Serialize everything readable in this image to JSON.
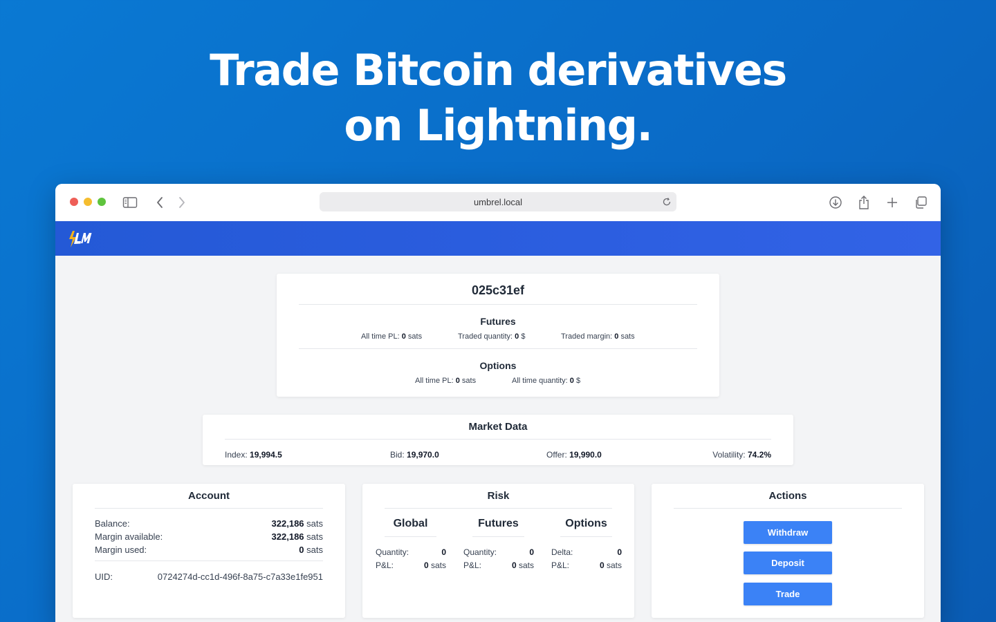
{
  "hero": {
    "line1": "Trade Bitcoin derivatives",
    "line2": "on Lightning."
  },
  "browser": {
    "url": "umbrel.local",
    "icons": [
      "sidebar-icon",
      "back-icon",
      "forward-icon",
      "reload-icon",
      "download-icon",
      "share-icon",
      "new-tab-icon",
      "tabs-overview-icon"
    ]
  },
  "app": {
    "logo_text": "LNM",
    "brand_color": "#2c5ee0",
    "accent_color": "#3b82f6"
  },
  "profile": {
    "title": "025c31ef",
    "futures": {
      "heading": "Futures",
      "all_time_pl_label": "All time PL:",
      "all_time_pl_value": "0",
      "all_time_pl_unit": "sats",
      "traded_quantity_label": "Traded quantity:",
      "traded_quantity_value": "0",
      "traded_quantity_unit": "$",
      "traded_margin_label": "Traded margin:",
      "traded_margin_value": "0",
      "traded_margin_unit": "sats"
    },
    "options": {
      "heading": "Options",
      "all_time_pl_label": "All time PL:",
      "all_time_pl_value": "0",
      "all_time_pl_unit": "sats",
      "all_time_quantity_label": "All time quantity:",
      "all_time_quantity_value": "0",
      "all_time_quantity_unit": "$"
    }
  },
  "market": {
    "title": "Market Data",
    "index_label": "Index:",
    "index_value": "19,994.5",
    "bid_label": "Bid:",
    "bid_value": "19,970.0",
    "offer_label": "Offer:",
    "offer_value": "19,990.0",
    "volatility_label": "Volatility:",
    "volatility_value": "74.2",
    "volatility_unit": "%"
  },
  "account": {
    "title": "Account",
    "balance_label": "Balance:",
    "balance_value": "322,186",
    "balance_unit": "sats",
    "margin_available_label": "Margin available:",
    "margin_available_value": "322,186",
    "margin_available_unit": "sats",
    "margin_used_label": "Margin used:",
    "margin_used_value": "0",
    "margin_used_unit": "sats",
    "uid_label": "UID:",
    "uid_value": "0724274d-cc1d-496f-8a75-c7a33e1fe951"
  },
  "risk": {
    "title": "Risk",
    "global": {
      "heading": "Global",
      "quantity_label": "Quantity:",
      "quantity_value": "0",
      "pl_label": "P&L:",
      "pl_value": "0",
      "pl_unit": "sats"
    },
    "futures": {
      "heading": "Futures",
      "quantity_label": "Quantity:",
      "quantity_value": "0",
      "pl_label": "P&L:",
      "pl_value": "0",
      "pl_unit": "sats"
    },
    "options": {
      "heading": "Options",
      "delta_label": "Delta:",
      "delta_value": "0",
      "pl_label": "P&L:",
      "pl_value": "0",
      "pl_unit": "sats"
    }
  },
  "actions": {
    "title": "Actions",
    "withdraw_label": "Withdraw",
    "deposit_label": "Deposit",
    "trade_label": "Trade"
  }
}
